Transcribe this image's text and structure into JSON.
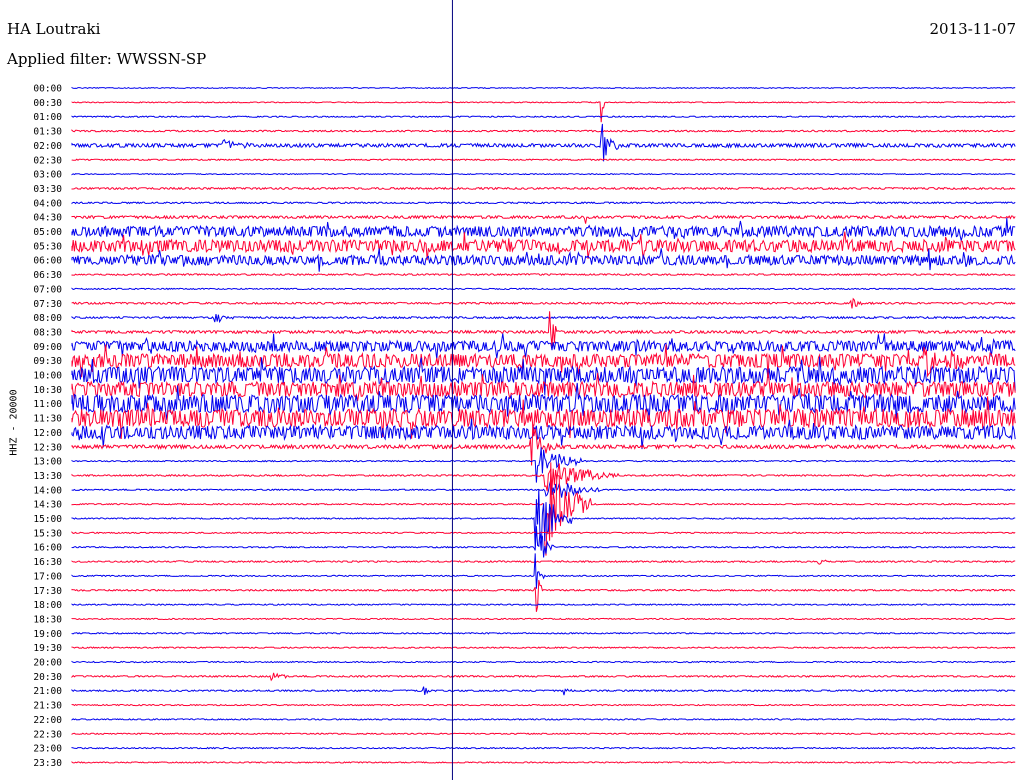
{
  "header": {
    "station": "HA Loutraki",
    "date": "2013-11-07",
    "filter": "Applied filter: WWSSN-SP"
  },
  "chart_data": {
    "type": "line",
    "ylabel": "HHZ - 20000",
    "colors": {
      "even": "#0000ee",
      "odd": "#ff0033",
      "marker": "#000080"
    },
    "marker_line_x_fraction": 0.403,
    "rows": [
      "00:00",
      "00:30",
      "01:00",
      "01:30",
      "02:00",
      "02:30",
      "03:00",
      "03:30",
      "04:00",
      "04:30",
      "05:00",
      "05:30",
      "06:00",
      "06:30",
      "07:00",
      "07:30",
      "08:00",
      "08:30",
      "09:00",
      "09:30",
      "10:00",
      "10:30",
      "11:00",
      "11:30",
      "12:00",
      "12:30",
      "13:00",
      "13:30",
      "14:00",
      "14:30",
      "15:00",
      "15:30",
      "16:00",
      "16:30",
      "17:00",
      "17:30",
      "18:00",
      "18:30",
      "19:00",
      "19:30",
      "20:00",
      "20:30",
      "21:00",
      "21:30",
      "22:00",
      "22:30",
      "23:00",
      "23:30"
    ],
    "noise_level": [
      0.3,
      0.3,
      0.4,
      0.5,
      1.2,
      0.4,
      0.3,
      0.6,
      0.5,
      0.9,
      3.5,
      4.0,
      3.2,
      0.5,
      0.4,
      0.6,
      0.6,
      0.9,
      3.5,
      4.5,
      5.5,
      5.0,
      6.0,
      6.0,
      4.5,
      1.2,
      0.4,
      0.5,
      0.4,
      0.4,
      0.4,
      0.4,
      0.4,
      0.5,
      0.4,
      0.5,
      0.4,
      0.4,
      0.4,
      0.4,
      0.4,
      0.5,
      0.5,
      0.4,
      0.4,
      0.4,
      0.4,
      0.4
    ],
    "events": [
      {
        "row": "00:30",
        "t": 0.56,
        "amp": 36,
        "len": 0.004
      },
      {
        "row": "02:00",
        "t": 0.56,
        "amp": 26,
        "len": 0.02
      },
      {
        "row": "02:00",
        "t": 0.16,
        "amp": 6,
        "len": 0.04
      },
      {
        "row": "04:30",
        "t": 0.544,
        "amp": 10,
        "len": 0.004
      },
      {
        "row": "05:00",
        "t": 0.99,
        "amp": 12,
        "len": 0.01
      },
      {
        "row": "07:30",
        "t": 0.825,
        "amp": 7,
        "len": 0.02
      },
      {
        "row": "08:00",
        "t": 0.15,
        "amp": 6,
        "len": 0.025
      },
      {
        "row": "08:30",
        "t": 0.505,
        "amp": 58,
        "len": 0.008
      },
      {
        "row": "09:30",
        "t": 0.9,
        "amp": 12,
        "len": 0.08
      },
      {
        "row": "12:30",
        "t": 0.485,
        "amp": 30,
        "len": 0.03
      },
      {
        "row": "13:00",
        "t": 0.49,
        "amp": 24,
        "len": 0.05
      },
      {
        "row": "13:30",
        "t": 0.5,
        "amp": 20,
        "len": 0.08
      },
      {
        "row": "14:00",
        "t": 0.5,
        "amp": 16,
        "len": 0.06
      },
      {
        "row": "14:30",
        "t": 0.5,
        "amp": 60,
        "len": 0.05
      },
      {
        "row": "15:00",
        "t": 0.49,
        "amp": 48,
        "len": 0.04
      },
      {
        "row": "16:00",
        "t": 0.49,
        "amp": 34,
        "len": 0.02
      },
      {
        "row": "17:00",
        "t": 0.49,
        "amp": 26,
        "len": 0.01
      },
      {
        "row": "17:30",
        "t": 0.49,
        "amp": 52,
        "len": 0.008
      },
      {
        "row": "16:30",
        "t": 0.79,
        "amp": 5,
        "len": 0.01
      },
      {
        "row": "20:30",
        "t": 0.21,
        "amp": 5,
        "len": 0.02
      },
      {
        "row": "21:00",
        "t": 0.372,
        "amp": 6,
        "len": 0.008
      },
      {
        "row": "21:00",
        "t": 0.52,
        "amp": 10,
        "len": 0.01
      }
    ]
  }
}
